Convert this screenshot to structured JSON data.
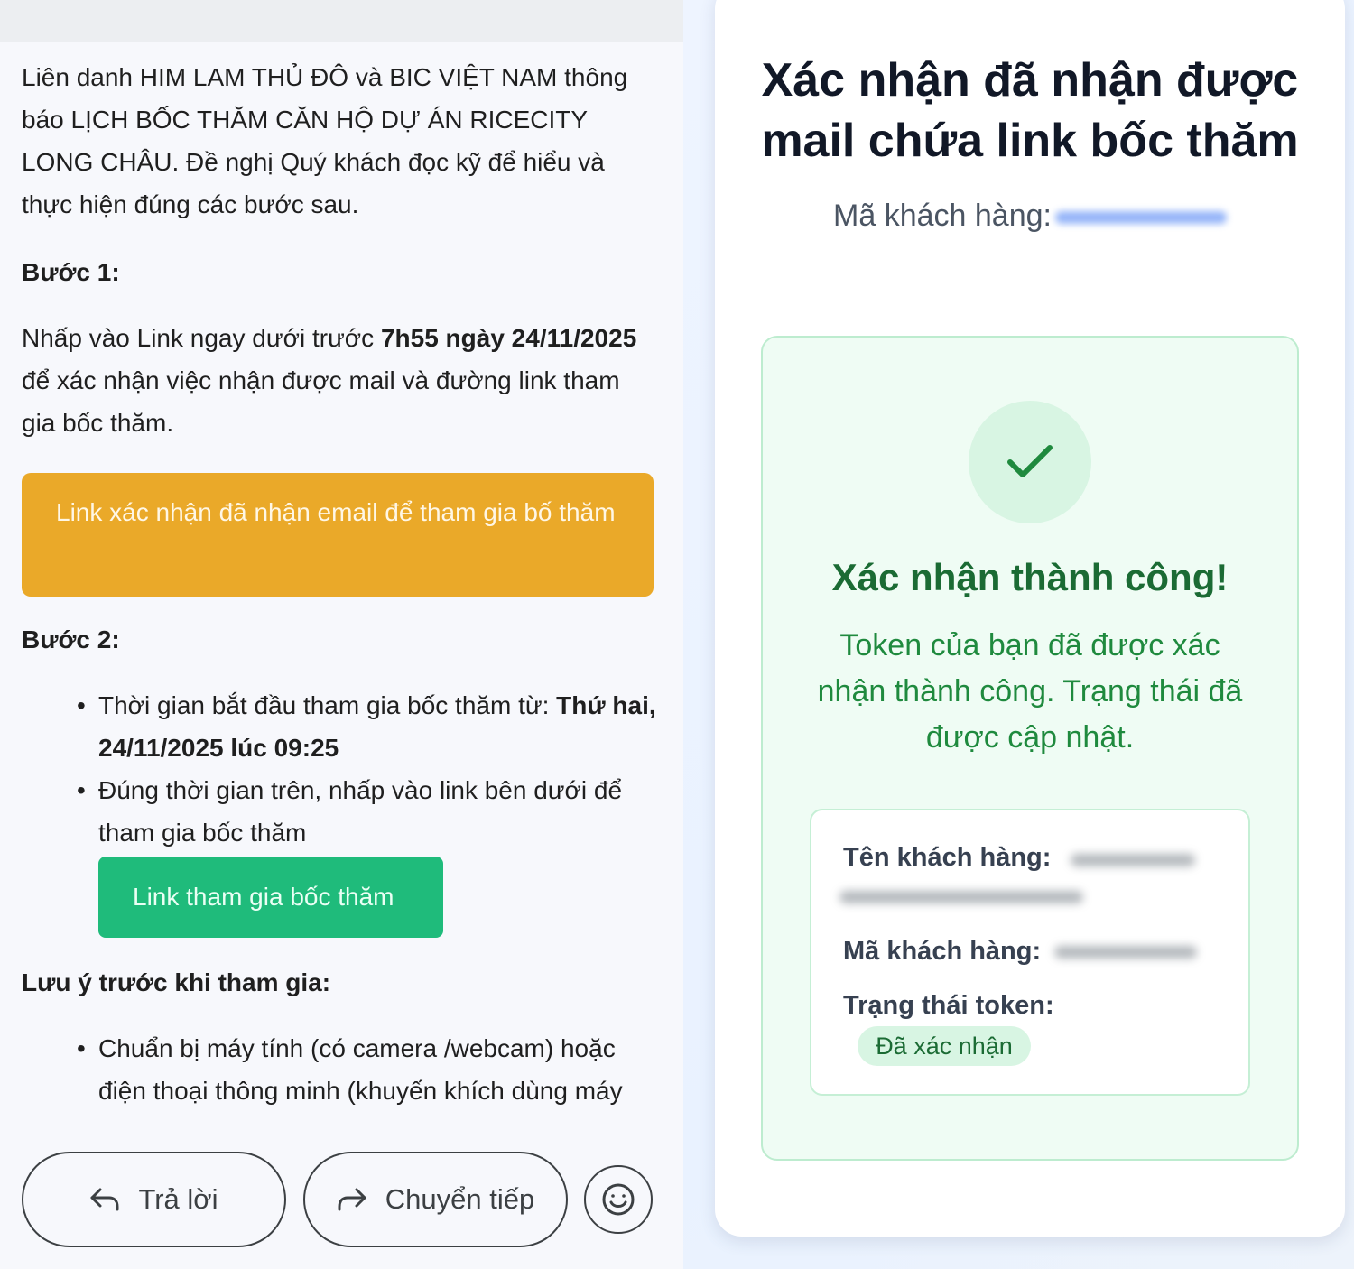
{
  "email": {
    "intro": "Liên danh HIM LAM THỦ ĐÔ và BIC VIỆT NAM thông báo LỊCH BỐC THĂM CĂN HỘ DỰ ÁN RICECITY LONG CHÂU. Đề nghị Quý khách đọc kỹ để hiểu và thực hiện đúng các bước sau.",
    "step1_label": "Bước 1:",
    "step1_text_a": "Nhấp vào Link ngay dưới trước ",
    "step1_text_bold": "7h55 ngày 24/11/2025",
    "step1_text_b": " để xác nhận việc nhận được mail và đường link tham gia bốc thăm.",
    "confirm_link_label": "Link xác nhận đã nhận email để tham gia bố thăm",
    "step2_label": "Bước 2:",
    "step2_bullet1_a": "Thời gian bắt đầu tham gia bốc thăm từ: ",
    "step2_bullet1_bold": "Thứ hai, 24/11/2025 lúc 09:25",
    "step2_bullet2": "Đúng thời gian trên, nhấp vào link bên dưới để tham gia bốc thăm",
    "join_link_label": "Link tham gia bốc thăm",
    "note_label": "Lưu ý trước khi tham gia:",
    "note_bullet1": "Chuẩn bị máy tính (có camera /webcam) hoặc điện thoại thông minh (khuyến khích dùng máy"
  },
  "actions": {
    "reply_label": "Trả lời",
    "forward_label": "Chuyển tiếp",
    "reply_icon": "reply-arrow-icon",
    "forward_icon": "forward-arrow-icon",
    "emoji_icon": "smiley-icon"
  },
  "confirmation": {
    "title": "Xác nhận đã nhận được mail chứa link bốc thăm",
    "customer_code_label": "Mã khách hàng:",
    "success_title": "Xác nhận thành công!",
    "success_message": "Token của bạn đã được xác nhận thành công. Trạng thái đã được cập nhật.",
    "info": {
      "name_label": "Tên khách hàng:",
      "code_label": "Mã khách hàng:",
      "status_label": "Trạng thái token:",
      "status_value": "Đã xác nhận"
    },
    "colors": {
      "accent_green": "#1b6b34",
      "orange_button": "#eaa929",
      "green_button": "#1fbb7b"
    }
  }
}
